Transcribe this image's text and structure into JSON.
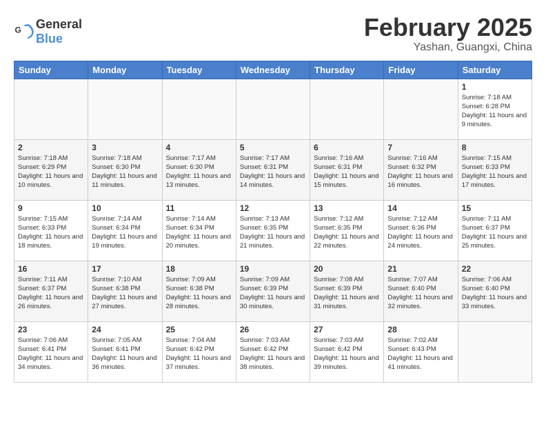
{
  "header": {
    "logo_general": "General",
    "logo_blue": "Blue",
    "title": "February 2025",
    "subtitle": "Yashan, Guangxi, China"
  },
  "weekdays": [
    "Sunday",
    "Monday",
    "Tuesday",
    "Wednesday",
    "Thursday",
    "Friday",
    "Saturday"
  ],
  "weeks": [
    [
      {
        "day": "",
        "info": ""
      },
      {
        "day": "",
        "info": ""
      },
      {
        "day": "",
        "info": ""
      },
      {
        "day": "",
        "info": ""
      },
      {
        "day": "",
        "info": ""
      },
      {
        "day": "",
        "info": ""
      },
      {
        "day": "1",
        "info": "Sunrise: 7:18 AM\nSunset: 6:28 PM\nDaylight: 11 hours and 9 minutes."
      }
    ],
    [
      {
        "day": "2",
        "info": "Sunrise: 7:18 AM\nSunset: 6:29 PM\nDaylight: 11 hours and 10 minutes."
      },
      {
        "day": "3",
        "info": "Sunrise: 7:18 AM\nSunset: 6:30 PM\nDaylight: 11 hours and 11 minutes."
      },
      {
        "day": "4",
        "info": "Sunrise: 7:17 AM\nSunset: 6:30 PM\nDaylight: 11 hours and 13 minutes."
      },
      {
        "day": "5",
        "info": "Sunrise: 7:17 AM\nSunset: 6:31 PM\nDaylight: 11 hours and 14 minutes."
      },
      {
        "day": "6",
        "info": "Sunrise: 7:16 AM\nSunset: 6:31 PM\nDaylight: 11 hours and 15 minutes."
      },
      {
        "day": "7",
        "info": "Sunrise: 7:16 AM\nSunset: 6:32 PM\nDaylight: 11 hours and 16 minutes."
      },
      {
        "day": "8",
        "info": "Sunrise: 7:15 AM\nSunset: 6:33 PM\nDaylight: 11 hours and 17 minutes."
      }
    ],
    [
      {
        "day": "9",
        "info": "Sunrise: 7:15 AM\nSunset: 6:33 PM\nDaylight: 11 hours and 18 minutes."
      },
      {
        "day": "10",
        "info": "Sunrise: 7:14 AM\nSunset: 6:34 PM\nDaylight: 11 hours and 19 minutes."
      },
      {
        "day": "11",
        "info": "Sunrise: 7:14 AM\nSunset: 6:34 PM\nDaylight: 11 hours and 20 minutes."
      },
      {
        "day": "12",
        "info": "Sunrise: 7:13 AM\nSunset: 6:35 PM\nDaylight: 11 hours and 21 minutes."
      },
      {
        "day": "13",
        "info": "Sunrise: 7:12 AM\nSunset: 6:35 PM\nDaylight: 11 hours and 22 minutes."
      },
      {
        "day": "14",
        "info": "Sunrise: 7:12 AM\nSunset: 6:36 PM\nDaylight: 11 hours and 24 minutes."
      },
      {
        "day": "15",
        "info": "Sunrise: 7:11 AM\nSunset: 6:37 PM\nDaylight: 11 hours and 25 minutes."
      }
    ],
    [
      {
        "day": "16",
        "info": "Sunrise: 7:11 AM\nSunset: 6:37 PM\nDaylight: 11 hours and 26 minutes."
      },
      {
        "day": "17",
        "info": "Sunrise: 7:10 AM\nSunset: 6:38 PM\nDaylight: 11 hours and 27 minutes."
      },
      {
        "day": "18",
        "info": "Sunrise: 7:09 AM\nSunset: 6:38 PM\nDaylight: 11 hours and 28 minutes."
      },
      {
        "day": "19",
        "info": "Sunrise: 7:09 AM\nSunset: 6:39 PM\nDaylight: 11 hours and 30 minutes."
      },
      {
        "day": "20",
        "info": "Sunrise: 7:08 AM\nSunset: 6:39 PM\nDaylight: 11 hours and 31 minutes."
      },
      {
        "day": "21",
        "info": "Sunrise: 7:07 AM\nSunset: 6:40 PM\nDaylight: 11 hours and 32 minutes."
      },
      {
        "day": "22",
        "info": "Sunrise: 7:06 AM\nSunset: 6:40 PM\nDaylight: 11 hours and 33 minutes."
      }
    ],
    [
      {
        "day": "23",
        "info": "Sunrise: 7:06 AM\nSunset: 6:41 PM\nDaylight: 11 hours and 34 minutes."
      },
      {
        "day": "24",
        "info": "Sunrise: 7:05 AM\nSunset: 6:41 PM\nDaylight: 11 hours and 36 minutes."
      },
      {
        "day": "25",
        "info": "Sunrise: 7:04 AM\nSunset: 6:42 PM\nDaylight: 11 hours and 37 minutes."
      },
      {
        "day": "26",
        "info": "Sunrise: 7:03 AM\nSunset: 6:42 PM\nDaylight: 11 hours and 38 minutes."
      },
      {
        "day": "27",
        "info": "Sunrise: 7:03 AM\nSunset: 6:42 PM\nDaylight: 11 hours and 39 minutes."
      },
      {
        "day": "28",
        "info": "Sunrise: 7:02 AM\nSunset: 6:43 PM\nDaylight: 11 hours and 41 minutes."
      },
      {
        "day": "",
        "info": ""
      }
    ]
  ]
}
